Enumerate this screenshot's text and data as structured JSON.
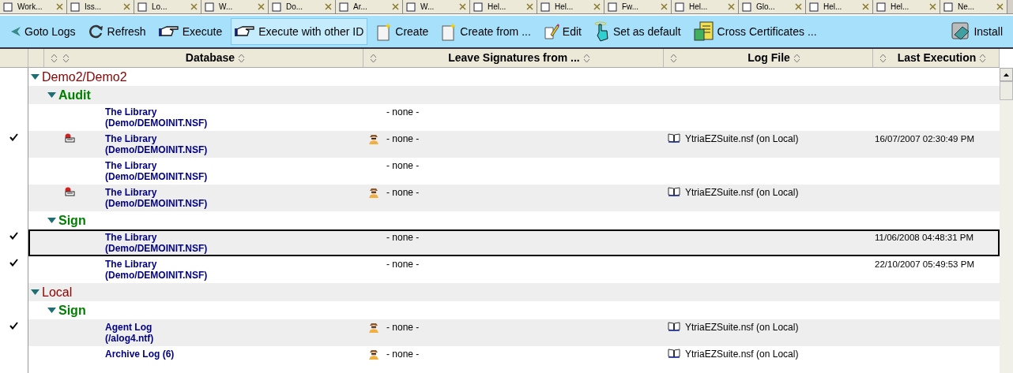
{
  "doc_tabs": [
    {
      "label": "Work..."
    },
    {
      "label": "Iss..."
    },
    {
      "label": "Lo..."
    },
    {
      "label": "W..."
    },
    {
      "label": "Do..."
    },
    {
      "label": "Ar..."
    },
    {
      "label": "W..."
    },
    {
      "label": "Hel..."
    },
    {
      "label": "Hel..."
    },
    {
      "label": "Fw..."
    },
    {
      "label": "Hel..."
    },
    {
      "label": "Glo..."
    },
    {
      "label": "Hel..."
    },
    {
      "label": "Hel..."
    },
    {
      "label": "Ne..."
    }
  ],
  "toolbar": [
    {
      "label": "Goto Logs",
      "kind": "back",
      "hovered": false
    },
    {
      "label": "Refresh",
      "kind": "refresh",
      "hovered": false
    },
    {
      "label": "Execute",
      "kind": "execute",
      "hovered": false
    },
    {
      "label": "Execute with other ID",
      "kind": "execute",
      "hovered": true
    },
    {
      "label": "Create",
      "kind": "create",
      "hovered": false
    },
    {
      "label": "Create from ...",
      "kind": "create",
      "hovered": false
    },
    {
      "label": "Edit",
      "kind": "edit",
      "hovered": false
    },
    {
      "label": "Set as default",
      "kind": "default",
      "hovered": false
    },
    {
      "label": "Cross Certificates ...",
      "kind": "certificates",
      "hovered": false
    },
    {
      "label": "Install",
      "kind": "install",
      "hovered": false
    }
  ],
  "columns": [
    {
      "label": "Database"
    },
    {
      "label": "Leave Signatures from ..."
    },
    {
      "label": "Log File"
    },
    {
      "label": "Last Execution"
    }
  ],
  "tree": [
    {
      "label": "Demo2/Demo2",
      "expanded": true,
      "children": [
        {
          "label": "Audit",
          "expanded": true,
          "children": [
            {
              "checked": false,
              "agent_icon": false,
              "title": "The Library",
              "path": "(Demo/DEMOINIT.NSF)",
              "signer_icon": false,
              "signatures": "- none -",
              "selected": false
            },
            {
              "checked": true,
              "agent_icon": true,
              "title": "The Library",
              "path": "(Demo/DEMOINIT.NSF)",
              "signer_icon": true,
              "signatures": "- none -",
              "log_file": "YtriaEZSuite.nsf (on Local)",
              "last_execution": "16/07/2007 02:30:49 PM",
              "selected": false
            },
            {
              "checked": false,
              "agent_icon": false,
              "title": "The Library",
              "path": "(Demo/DEMOINIT.NSF)",
              "signer_icon": false,
              "signatures": "- none -",
              "selected": false
            },
            {
              "checked": false,
              "agent_icon": true,
              "title": "The Library",
              "path": "(Demo/DEMOINIT.NSF)",
              "signer_icon": true,
              "signatures": "- none -",
              "log_file": "YtriaEZSuite.nsf (on Local)",
              "selected": false
            }
          ]
        },
        {
          "label": "Sign",
          "expanded": true,
          "children": [
            {
              "checked": true,
              "agent_icon": false,
              "title": "The Library",
              "path": "(Demo/DEMOINIT.NSF)",
              "signer_icon": false,
              "signatures": "- none -",
              "last_execution": "11/06/2008 04:48:31 PM",
              "selected": true
            },
            {
              "checked": true,
              "agent_icon": false,
              "title": "The Library",
              "path": "(Demo/DEMOINIT.NSF)",
              "signer_icon": false,
              "signatures": "- none -",
              "last_execution": "22/10/2007 05:49:53 PM",
              "selected": false
            }
          ]
        }
      ]
    },
    {
      "label": "Local",
      "expanded": true,
      "children": [
        {
          "label": "Sign",
          "expanded": true,
          "children": [
            {
              "checked": true,
              "agent_icon": false,
              "title": "Agent Log",
              "path": "(/alog4.ntf)",
              "signer_icon": true,
              "signatures": "- none -",
              "log_file": "YtriaEZSuite.nsf (on Local)",
              "selected": false
            },
            {
              "checked": false,
              "agent_icon": false,
              "title": "Archive Log (6)",
              "signer_icon": true,
              "signatures": "- none -",
              "log_file": "YtriaEZSuite.nsf (on Local)",
              "selected": false
            }
          ]
        }
      ]
    }
  ]
}
